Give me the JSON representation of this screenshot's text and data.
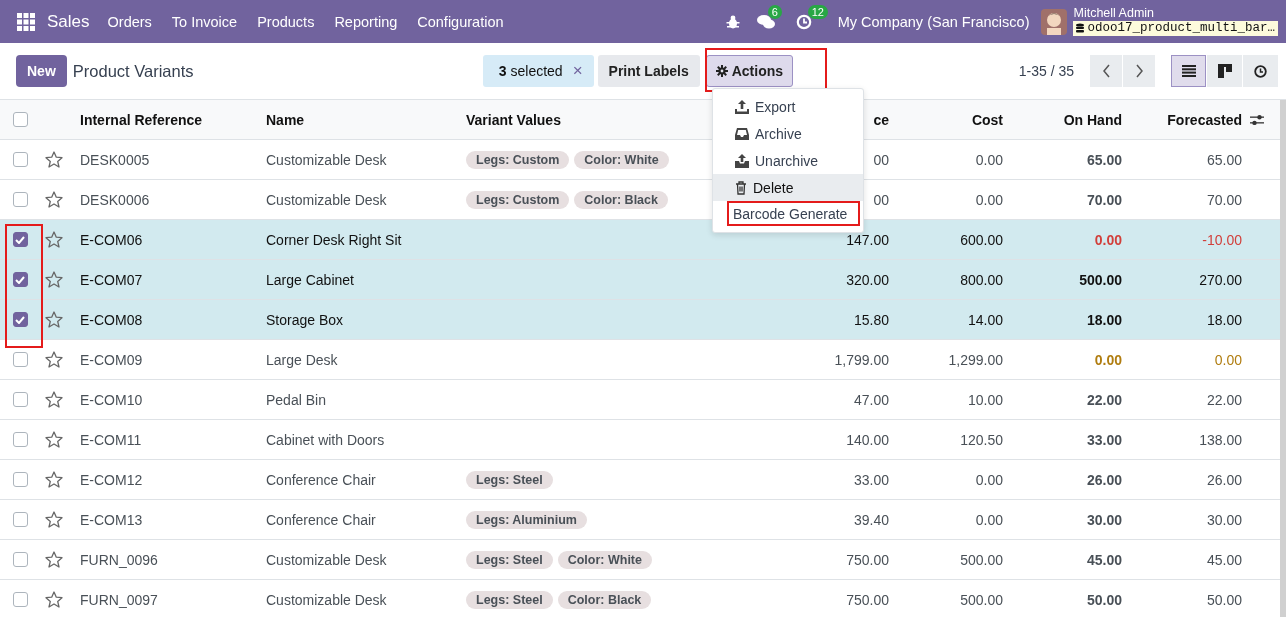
{
  "navbar": {
    "app": "Sales",
    "menu": [
      "Orders",
      "To Invoice",
      "Products",
      "Reporting",
      "Configuration"
    ],
    "messages_badge": "6",
    "activities_badge": "12",
    "company": "My Company (San Francisco)",
    "user": "Mitchell Admin",
    "database": "odoo17_product_multi_bar…"
  },
  "control_panel": {
    "new_button": "New",
    "title": "Product Variants",
    "selection_count": "3",
    "selection_label": "selected",
    "clear_selection": "×",
    "print_button": "Print Labels",
    "actions_button": "Actions",
    "actions_open": true,
    "actions_highlighted": true,
    "pager": "1-35 / 35",
    "views": [
      {
        "kind": "list",
        "selected": true
      },
      {
        "kind": "kanban",
        "selected": false
      },
      {
        "kind": "activity",
        "selected": false
      }
    ]
  },
  "actions_menu": [
    {
      "label": "Export",
      "has_icon": true,
      "hovered": false,
      "highlighted": false
    },
    {
      "label": "Archive",
      "has_icon": true,
      "hovered": false,
      "highlighted": false
    },
    {
      "label": "Unarchive",
      "has_icon": true,
      "hovered": false,
      "highlighted": false
    },
    {
      "label": "Delete",
      "has_icon": true,
      "hovered": true,
      "highlighted": false
    },
    {
      "label": "Barcode Generate",
      "has_icon": false,
      "hovered": false,
      "highlighted": true
    }
  ],
  "table": {
    "select_all_checked": false,
    "checkbox_column_highlighted": true,
    "columns": [
      "Internal Reference",
      "Name",
      "Variant Values",
      "ce",
      "Cost",
      "On Hand",
      "Forecasted"
    ],
    "rows": [
      {
        "selected": false,
        "reference": "DESK0005",
        "name": "Customizable Desk",
        "variants": [
          "Legs: Custom",
          "Color: White"
        ],
        "price": "00",
        "cost": "0.00",
        "on_hand": "65.00",
        "forecasted": "65.00",
        "kind": "normal"
      },
      {
        "selected": false,
        "reference": "DESK0006",
        "name": "Customizable Desk",
        "variants": [
          "Legs: Custom",
          "Color: Black"
        ],
        "price": "00",
        "cost": "0.00",
        "on_hand": "70.00",
        "forecasted": "70.00",
        "kind": "normal"
      },
      {
        "selected": true,
        "reference": "E-COM06",
        "name": "Corner Desk Right Sit",
        "variants": [],
        "price": "147.00",
        "cost": "600.00",
        "on_hand": "0.00",
        "forecasted": "-10.00",
        "kind": "negative"
      },
      {
        "selected": true,
        "reference": "E-COM07",
        "name": "Large Cabinet",
        "variants": [],
        "price": "320.00",
        "cost": "800.00",
        "on_hand": "500.00",
        "forecasted": "270.00",
        "kind": "normal"
      },
      {
        "selected": true,
        "reference": "E-COM08",
        "name": "Storage Box",
        "variants": [],
        "price": "15.80",
        "cost": "14.00",
        "on_hand": "18.00",
        "forecasted": "18.00",
        "kind": "normal"
      },
      {
        "selected": false,
        "reference": "E-COM09",
        "name": "Large Desk",
        "variants": [],
        "price": "1,799.00",
        "cost": "1,299.00",
        "on_hand": "0.00",
        "forecasted": "0.00",
        "kind": "zero"
      },
      {
        "selected": false,
        "reference": "E-COM10",
        "name": "Pedal Bin",
        "variants": [],
        "price": "47.00",
        "cost": "10.00",
        "on_hand": "22.00",
        "forecasted": "22.00",
        "kind": "normal"
      },
      {
        "selected": false,
        "reference": "E-COM11",
        "name": "Cabinet with Doors",
        "variants": [],
        "price": "140.00",
        "cost": "120.50",
        "on_hand": "33.00",
        "forecasted": "138.00",
        "kind": "normal"
      },
      {
        "selected": false,
        "reference": "E-COM12",
        "name": "Conference Chair",
        "variants": [
          "Legs: Steel"
        ],
        "price": "33.00",
        "cost": "0.00",
        "on_hand": "26.00",
        "forecasted": "26.00",
        "kind": "normal"
      },
      {
        "selected": false,
        "reference": "E-COM13",
        "name": "Conference Chair",
        "variants": [
          "Legs: Aluminium"
        ],
        "price": "39.40",
        "cost": "0.00",
        "on_hand": "30.00",
        "forecasted": "30.00",
        "kind": "normal"
      },
      {
        "selected": false,
        "reference": "FURN_0096",
        "name": "Customizable Desk",
        "variants": [
          "Legs: Steel",
          "Color: White"
        ],
        "price": "750.00",
        "cost": "500.00",
        "on_hand": "45.00",
        "forecasted": "45.00",
        "kind": "normal"
      },
      {
        "selected": false,
        "reference": "FURN_0097",
        "name": "Customizable Desk",
        "variants": [
          "Legs: Steel",
          "Color: Black"
        ],
        "price": "750.00",
        "cost": "500.00",
        "on_hand": "50.00",
        "forecasted": "50.00",
        "kind": "normal"
      }
    ]
  }
}
